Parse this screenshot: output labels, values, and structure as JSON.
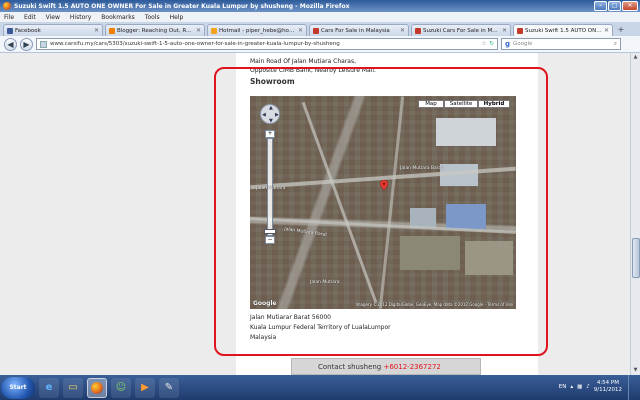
{
  "window": {
    "title": "Suzuki Swift 1.5 AUTO ONE OWNER For Sale in Greater Kuala Lumpur by shusheng - Mozilla Firefox"
  },
  "menu": [
    "File",
    "Edit",
    "View",
    "History",
    "Bookmarks",
    "Tools",
    "Help"
  ],
  "tabs": [
    {
      "label": "Facebook",
      "icon": "facebook-icon",
      "color": "#3b5998"
    },
    {
      "label": "Blogger: Reaching Out, Reachi...",
      "icon": "blogger-icon",
      "color": "#f57d00"
    },
    {
      "label": "Hotmail - piper_hebe@hotmail.c...",
      "icon": "hotmail-icon",
      "color": "#f3a31b"
    },
    {
      "label": "Cars For Sale in Malaysia",
      "icon": "site-icon",
      "color": "#c23b2a"
    },
    {
      "label": "Suzuki Cars For Sale in Malaysia...",
      "icon": "site-icon",
      "color": "#c23b2a"
    },
    {
      "label": "Suzuki Swift 1.5 AUTO ONE OW...",
      "icon": "site-icon",
      "color": "#c23b2a"
    }
  ],
  "nav": {
    "url": "www.carsifu.my/cars/5303/suzuki-swift-1-5-auto-one-owner-for-sale-in-greater-kuala-lumpur-by-shusheng",
    "search_placeholder": "Google"
  },
  "page": {
    "address_top": [
      "Main Road Of Jalan Mutiara Charas,",
      "Opposite CIMB Bank, Nearby Leisure Mall."
    ],
    "showroom_heading": "Showroom",
    "map": {
      "types": [
        "Map",
        "Satellite",
        "Hybrid"
      ],
      "active_type": "Hybrid",
      "copyright": "Imagery ©2012 DigitalGlobe, GeoEye, Map data ©2012 Google - Terms of Use",
      "google_mark": "Google",
      "labels": [
        "Jalan Mutiara",
        "Jalan Mutiara Barat",
        "Jalan Mutiara Barat",
        "Jalan Mutiara"
      ]
    },
    "address_bottom": [
      "Jalan Mutiarar Barat 56000",
      "Kuala Lumpur Federal Territory of LualaLumpor",
      "Malaysia"
    ],
    "contact": {
      "label": "Contact shusheng",
      "phone": "+6012-2367272"
    },
    "highlight_color": "#e0141e"
  },
  "taskbar": {
    "start": "Start",
    "apps": [
      "ie-icon",
      "explorer-icon",
      "firefox-icon",
      "messenger-icon",
      "media-player-icon",
      "paint-icon"
    ],
    "language": "EN",
    "time": "4:54 PM",
    "date": "9/11/2012"
  }
}
